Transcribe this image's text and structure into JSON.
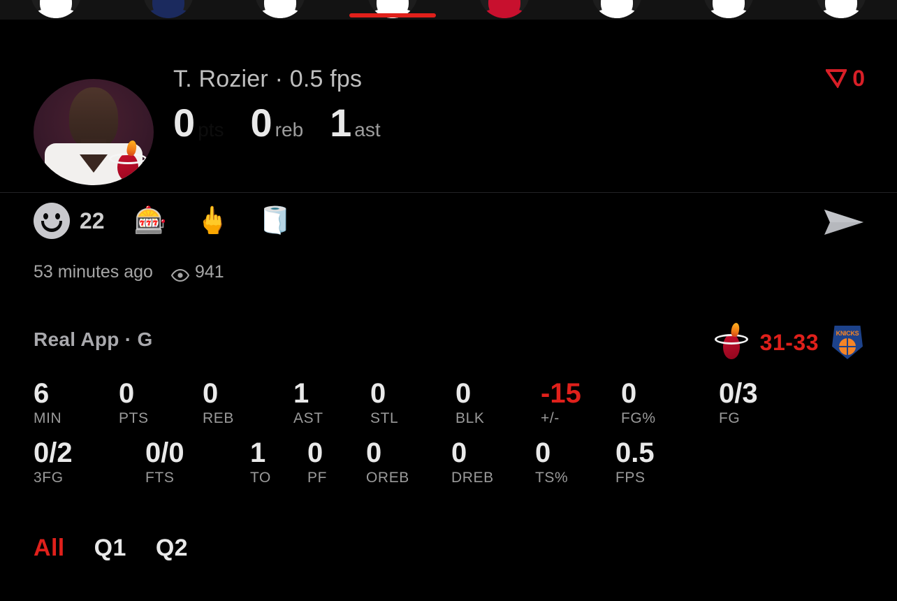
{
  "colors": {
    "background": "#000000",
    "accent_red": "#e0201b",
    "text_primary": "#e9e9e9",
    "text_secondary": "#9a9a9a",
    "divider": "#222226"
  },
  "avatar_strip": {
    "active_index": 3,
    "items": [
      {
        "name": "story-avatar-1",
        "tint": "#ffffff"
      },
      {
        "name": "story-avatar-2",
        "tint": "#1b2a5e"
      },
      {
        "name": "story-avatar-3",
        "tint": "#ffffff"
      },
      {
        "name": "story-avatar-4",
        "tint": "#ffffff"
      },
      {
        "name": "story-avatar-5",
        "tint": "#c8102e"
      },
      {
        "name": "story-avatar-6",
        "tint": "#ffffff"
      },
      {
        "name": "story-avatar-7",
        "tint": "#ffffff"
      },
      {
        "name": "story-avatar-8",
        "tint": "#ffffff"
      }
    ]
  },
  "player_header": {
    "avatar_icon": "player-headshot",
    "team_logo_icon": "miami-heat-logo",
    "name_line": "T. Rozier · 0.5 fps",
    "quick_stats": [
      {
        "value": "0",
        "label": "pts",
        "dim": true
      },
      {
        "value": "0",
        "label": "reb",
        "dim": false
      },
      {
        "value": "1",
        "label": "ast",
        "dim": false
      }
    ],
    "rank": {
      "icon": "down-arrow-icon",
      "value": "0"
    }
  },
  "reactions": {
    "smiley_icon": "smiley-face-icon",
    "count": "22",
    "emojis": [
      {
        "name": "slot-machine-emoji",
        "glyph": "🎰"
      },
      {
        "name": "middle-finger-emoji",
        "glyph": "🖕"
      },
      {
        "name": "toilet-paper-emoji",
        "glyph": "🧻"
      }
    ],
    "send_icon": "send-icon"
  },
  "meta": {
    "timestamp": "53 minutes ago",
    "views_icon": "eye-icon",
    "views": "941"
  },
  "game": {
    "title": "Real App · G",
    "home_logo_icon": "miami-heat-logo",
    "away_logo_icon": "new-york-knicks-logo",
    "score": "31-33"
  },
  "stats": {
    "row1": [
      {
        "value": "6",
        "label": "MIN",
        "negative": false
      },
      {
        "value": "0",
        "label": "PTS",
        "negative": false
      },
      {
        "value": "0",
        "label": "REB",
        "negative": false
      },
      {
        "value": "1",
        "label": "AST",
        "negative": false
      },
      {
        "value": "0",
        "label": "STL",
        "negative": false
      },
      {
        "value": "0",
        "label": "BLK",
        "negative": false
      },
      {
        "value": "-15",
        "label": "+/-",
        "negative": true
      },
      {
        "value": "0",
        "label": "FG%",
        "negative": false
      },
      {
        "value": "0/3",
        "label": "FG",
        "negative": false
      }
    ],
    "row2": [
      {
        "value": "0/2",
        "label": "3FG",
        "negative": false
      },
      {
        "value": "0/0",
        "label": "FTS",
        "negative": false
      },
      {
        "value": "1",
        "label": "TO",
        "negative": false
      },
      {
        "value": "0",
        "label": "PF",
        "negative": false
      },
      {
        "value": "0",
        "label": "OREB",
        "negative": false
      },
      {
        "value": "0",
        "label": "DREB",
        "negative": false
      },
      {
        "value": "0",
        "label": "TS%",
        "negative": false
      },
      {
        "value": "0.5",
        "label": "FPS",
        "negative": false
      }
    ]
  },
  "quarter_tabs": [
    {
      "label": "All",
      "active": true
    },
    {
      "label": "Q1",
      "active": false
    },
    {
      "label": "Q2",
      "active": false
    }
  ]
}
